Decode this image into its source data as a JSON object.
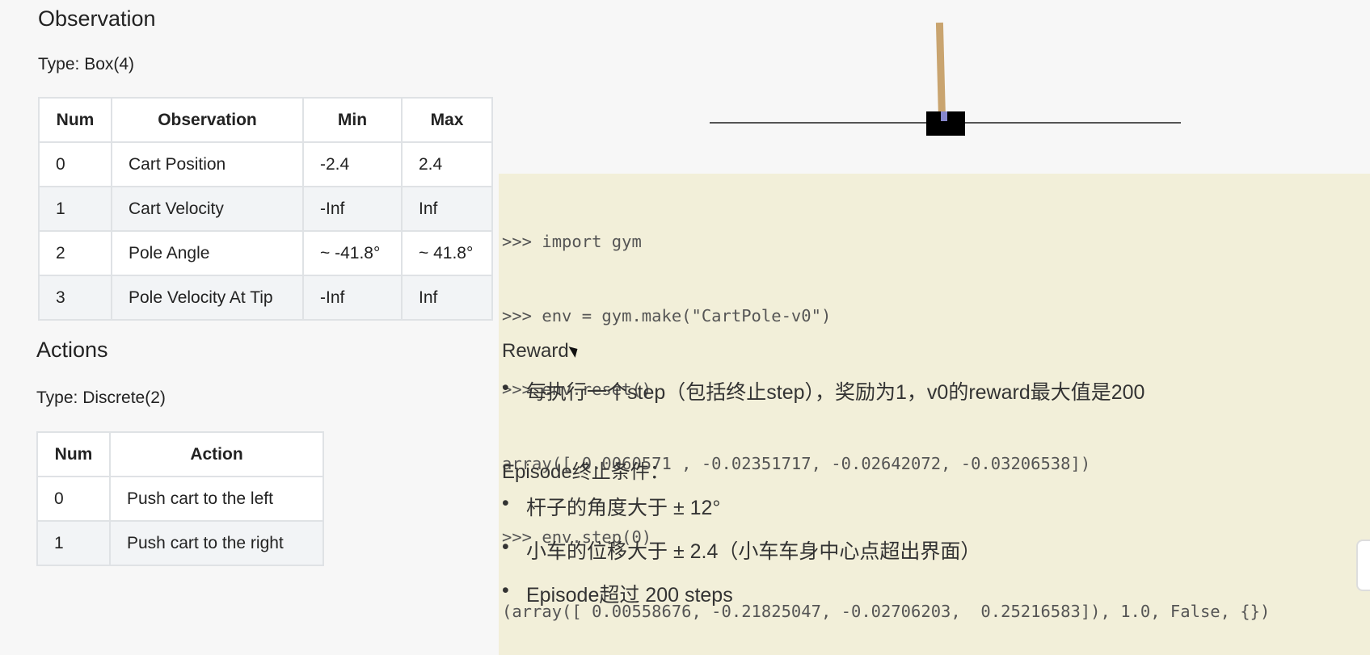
{
  "observation": {
    "heading": "Observation",
    "type_line": "Type: Box(4)",
    "headers": [
      "Num",
      "Observation",
      "Min",
      "Max"
    ],
    "rows": [
      [
        "0",
        "Cart Position",
        "-2.4",
        "2.4"
      ],
      [
        "1",
        "Cart Velocity",
        "-Inf",
        "Inf"
      ],
      [
        "2",
        "Pole Angle",
        "~ -41.8°",
        "~ 41.8°"
      ],
      [
        "3",
        "Pole Velocity At Tip",
        "-Inf",
        "Inf"
      ]
    ]
  },
  "actions": {
    "heading": "Actions",
    "type_line": "Type: Discrete(2)",
    "headers": [
      "Num",
      "Action"
    ],
    "rows": [
      [
        "0",
        "Push cart to the left"
      ],
      [
        "1",
        "Push cart to the right"
      ]
    ]
  },
  "code": {
    "lines": [
      ">>> import gym",
      ">>> env = gym.make(\"CartPole-v0\")",
      ">>> env.reset()",
      "array([ 0.0060571 , -0.02351717, -0.02642072, -0.03206538])",
      ">>> env.step(0)",
      "(array([ 0.00558676, -0.21825047, -0.02706203,  0.25216583]), 1.0, False, {})"
    ]
  },
  "reward": {
    "label": "Reward",
    "items": [
      "每执行一个step（包括终止step），奖励为1，v0的reward最大值是200"
    ]
  },
  "episode": {
    "label": "Episode终止条件：",
    "items": [
      "杆子的角度大于 ± 12°",
      "小车的位移大于 ± 2.4（小车车身中心点超出界面）",
      "Episode超过 200 steps"
    ]
  },
  "colors": {
    "code_bg": "#f2efd9",
    "table_border": "#dfe2e5",
    "pole": "#c9a46f",
    "cart": "#000000"
  }
}
